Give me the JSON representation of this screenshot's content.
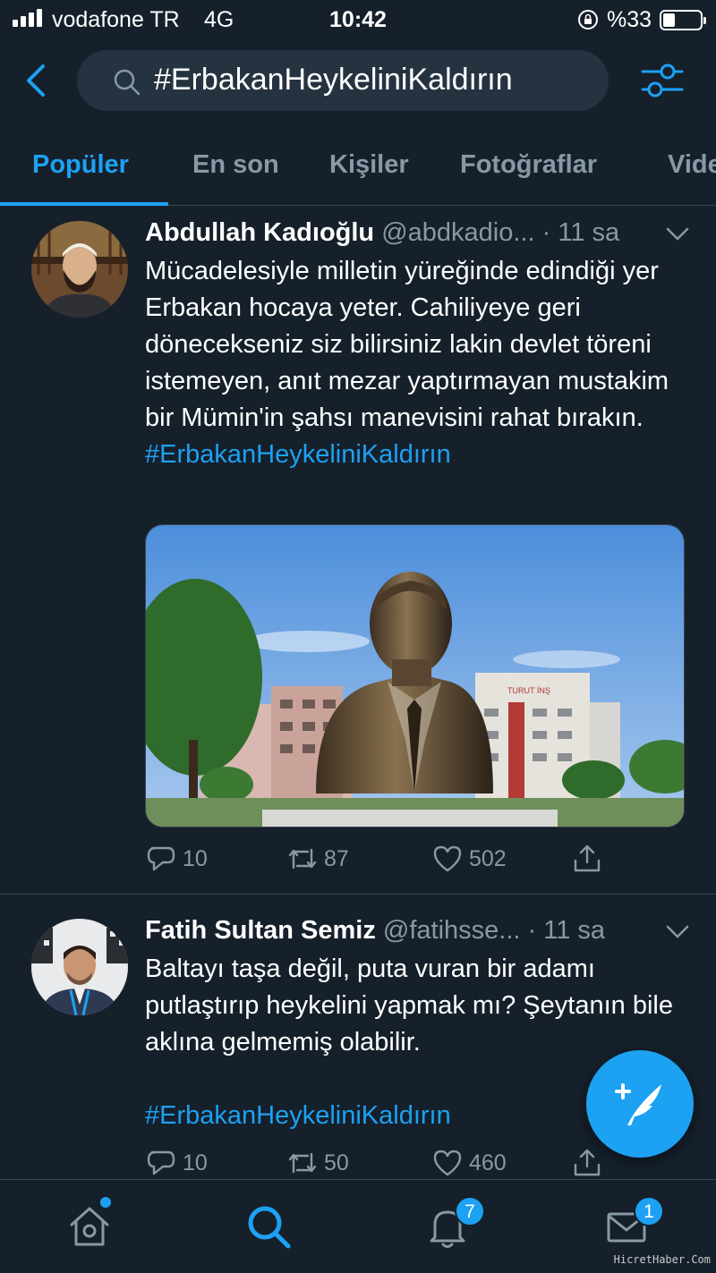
{
  "status_bar": {
    "carrier": "vodafone TR",
    "network": "4G",
    "time": "10:42",
    "battery": "%33"
  },
  "search": {
    "query": "#ErbakanHeykeliniKaldırın"
  },
  "tabs": [
    {
      "label": "Popüler",
      "active": true
    },
    {
      "label": "En son",
      "active": false
    },
    {
      "label": "Kişiler",
      "active": false
    },
    {
      "label": "Fotoğraflar",
      "active": false
    },
    {
      "label": "Vide",
      "active": false
    }
  ],
  "tweets": [
    {
      "name": "Abdullah Kadıoğlu",
      "handle": "@abdkadio...",
      "time": "· 11 sa",
      "text": "Mücadelesiyle milletin yüreğinde edindiği yer Erbakan hocaya yeter. Cahiliyeye geri dönecekseniz siz bilirsiniz lakin devlet töreni istemeyen, anıt mezar yaptırmayan mustakim bir Mümin'in şahsı manevisini rahat bırakın.",
      "hashtag": "#ErbakanHeykeliniKaldırın",
      "replies": "10",
      "retweets": "87",
      "likes": "502",
      "media_sign": "TURUT İNŞ"
    },
    {
      "name": "Fatih Sultan Semiz",
      "handle": "@fatihsse...",
      "time": "· 11 sa",
      "text": "Baltayı taşa değil, puta vuran bir adamı putlaştırıp heykelini yapmak mı? Şeytanın bile aklına gelmemiş olabilir.",
      "hashtag": "#ErbakanHeykeliniKaldırın",
      "replies": "10",
      "retweets": "50",
      "likes": "460"
    }
  ],
  "bottom_nav": {
    "notifications_badge": "7",
    "messages_badge": "1"
  },
  "watermark": "HicretHaber.Com",
  "colors": {
    "background": "#15202b",
    "accent": "#1da1f2",
    "secondary_text": "#8899a6",
    "divider": "#38444d"
  },
  "icons": [
    "back-arrow-icon",
    "search-icon",
    "filter-sliders-icon",
    "reply-icon",
    "retweet-icon",
    "like-icon",
    "share-icon",
    "compose-tweet-icon",
    "home-icon",
    "explore-search-icon",
    "notifications-bell-icon",
    "messages-envelope-icon"
  ]
}
